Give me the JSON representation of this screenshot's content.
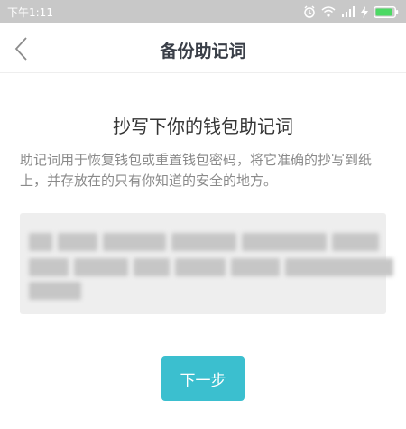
{
  "status_bar": {
    "time": "下午1:11",
    "battery_level": 0.9,
    "battery_color": "#4cd964"
  },
  "nav": {
    "title": "备份助记词"
  },
  "main": {
    "heading": "抄写下你的钱包助记词",
    "description": "助记词用于恢复钱包或重置钱包密码，将它准确的抄写到纸上，并存放在的只有你知道的安全的地方。",
    "next_label": "下一步",
    "accent_color": "#3bbfcf"
  }
}
